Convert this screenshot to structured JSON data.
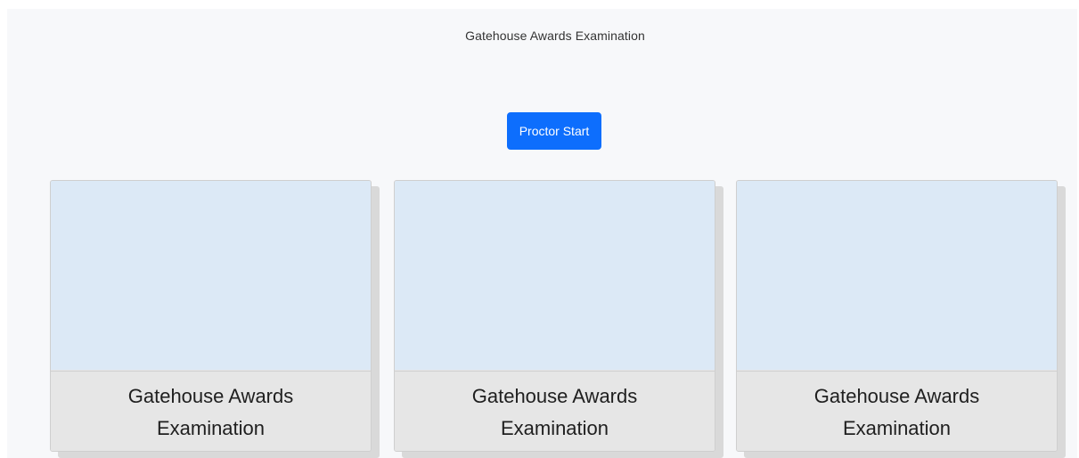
{
  "header": {
    "title": "Gatehouse Awards Examination"
  },
  "actions": {
    "proctor_start_label": "Proctor Start"
  },
  "cards": [
    {
      "title": "Gatehouse Awards Examination"
    },
    {
      "title": "Gatehouse Awards Examination"
    },
    {
      "title": "Gatehouse Awards Examination"
    }
  ],
  "colors": {
    "primary": "#0d6efd",
    "card_image_bg": "#dce9f6",
    "card_caption_bg": "#e6e6e6",
    "page_bg": "#f7f8fa"
  }
}
